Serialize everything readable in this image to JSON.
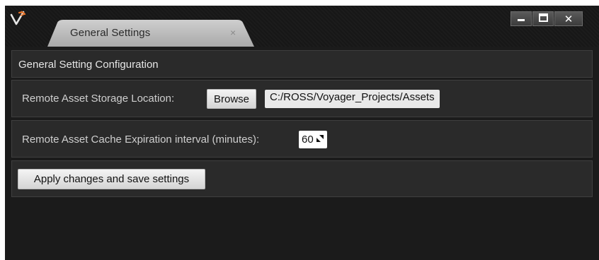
{
  "window": {
    "tab_title": "General Settings",
    "tab_close_glyph": "×",
    "controls": {
      "minimize_icon": "minimize-icon",
      "maximize_icon": "maximize-icon",
      "close_icon": "close-icon",
      "close_glyph": "✕"
    }
  },
  "settings": {
    "section_title": "General Setting Configuration",
    "storage": {
      "label": "Remote Asset Storage Location:",
      "browse_label": "Browse",
      "path_value": "C:/ROSS/Voyager_Projects/Assets"
    },
    "cache": {
      "label": "Remote Asset Cache Expiration interval (minutes):",
      "value": "60"
    },
    "apply_label": "Apply changes and save settings"
  },
  "colors": {
    "window_bg": "#1b1b1b",
    "panel_bg": "#2a2a2a",
    "logo_orange": "#e8742a",
    "tab_bg": "#b9b9b9"
  }
}
